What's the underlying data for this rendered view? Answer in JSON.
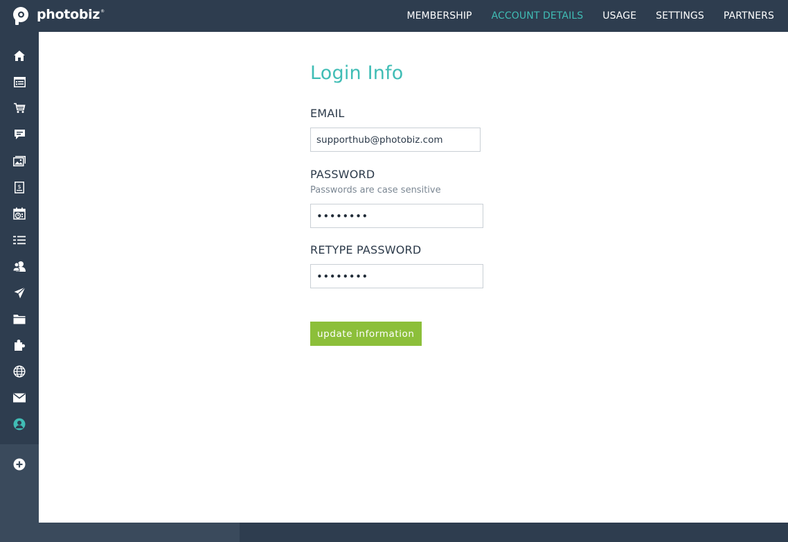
{
  "brand": {
    "name": "photobiz",
    "reg": "®",
    "logo_icon": "photobiz-p-logo"
  },
  "topnav": {
    "items": [
      {
        "label": "MEMBERSHIP",
        "active": false
      },
      {
        "label": "ACCOUNT DETAILS",
        "active": true
      },
      {
        "label": "USAGE",
        "active": false
      },
      {
        "label": "SETTINGS",
        "active": false
      },
      {
        "label": "PARTNERS",
        "active": false
      }
    ]
  },
  "sidebar": {
    "icons": [
      "home-icon",
      "website-icon",
      "cart-icon",
      "chat-icon",
      "gallery-icon",
      "invoice-icon",
      "calendar-icon",
      "list-icon",
      "contacts-icon",
      "send-icon",
      "folder-icon",
      "puzzle-icon",
      "globe-icon",
      "mail-icon",
      "account-icon",
      "add-icon"
    ],
    "active_icon": "account-icon"
  },
  "form": {
    "title": "Login Info",
    "email_label": "EMAIL",
    "email_value": "supporthub@photobiz.com",
    "password_label": "PASSWORD",
    "password_hint": "Passwords are case sensitive",
    "password_value": "••••••••",
    "retype_label": "RETYPE PASSWORD",
    "retype_value": "••••••••",
    "submit_label": "update information"
  },
  "colors": {
    "navbar": "#2e3d4f",
    "accent": "#40bdb5",
    "button": "#8cbf3a"
  }
}
